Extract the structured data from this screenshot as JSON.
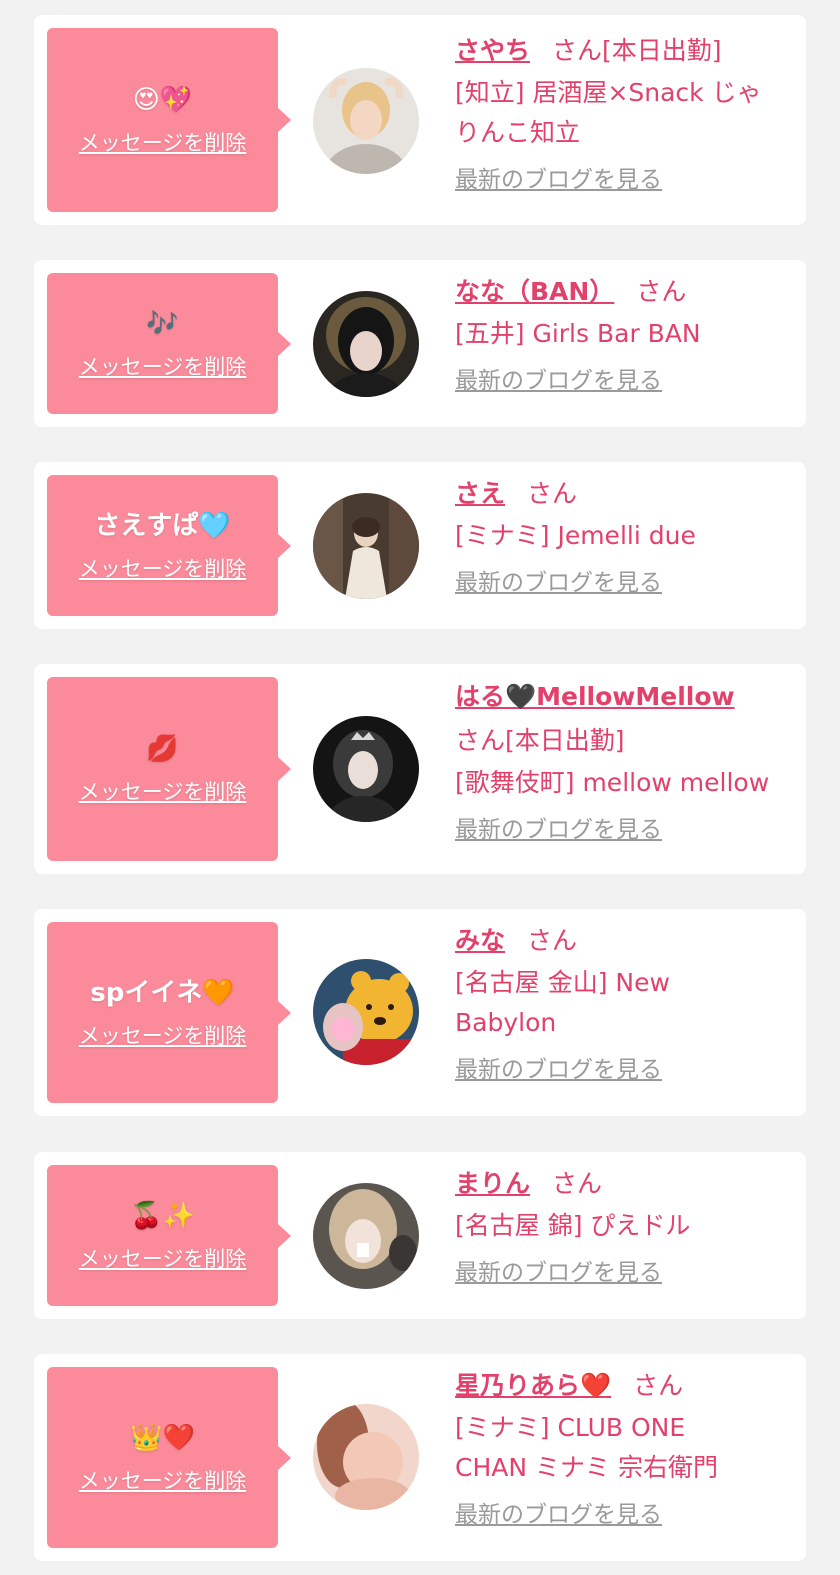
{
  "accent": "#e2416b",
  "bubble_color": "#fb8a9a",
  "delete_label": "メッセージを削除",
  "blog_label": "最新のブログを見る",
  "honorific": "さん",
  "cards": [
    {
      "message": "😍💖",
      "name": "さやち",
      "attendance": "[本日出勤]",
      "area": "[知立]",
      "shop_line1": "[知立] 居酒屋×Snack じゃ",
      "shop_line2": "りんこ知立",
      "avatar_icon": "blonde-woman-avatar"
    },
    {
      "message": "🎶",
      "name": "なな（BAN）",
      "attendance": "",
      "shop_line1": "[五井] Girls Bar BAN",
      "shop_line2": "",
      "avatar_icon": "dark-hair-woman-avatar"
    },
    {
      "message": "さえすぱ🩵",
      "name": "さえ",
      "attendance": "",
      "shop_line1": "[ミナミ] Jemelli due",
      "shop_line2": "",
      "avatar_icon": "kimono-woman-avatar"
    },
    {
      "message": "💋",
      "name": "はる🖤MellowMellow",
      "attendance": "[本日出勤]",
      "shop_line1": "[歌舞伎町] mellow mellow",
      "shop_line2": "",
      "avatar_icon": "tiara-woman-avatar"
    },
    {
      "message": "spイイネ🧡",
      "name": "みな",
      "attendance": "",
      "shop_line1": "[名古屋 金山] New",
      "shop_line2": "Babylon",
      "avatar_icon": "bear-mascot-avatar"
    },
    {
      "message": "🍒✨",
      "name": "まりん",
      "attendance": "",
      "shop_line1": "[名古屋 錦] ぴえドル",
      "shop_line2": "",
      "avatar_icon": "ribbon-woman-avatar"
    },
    {
      "message": "👑❤️",
      "name": "星乃りあら❤️",
      "attendance": "",
      "shop_line1": "[ミナミ] CLUB ONE",
      "shop_line2": "CHAN ミナミ 宗右衛門",
      "avatar_icon": "blurred-portrait-avatar"
    }
  ]
}
